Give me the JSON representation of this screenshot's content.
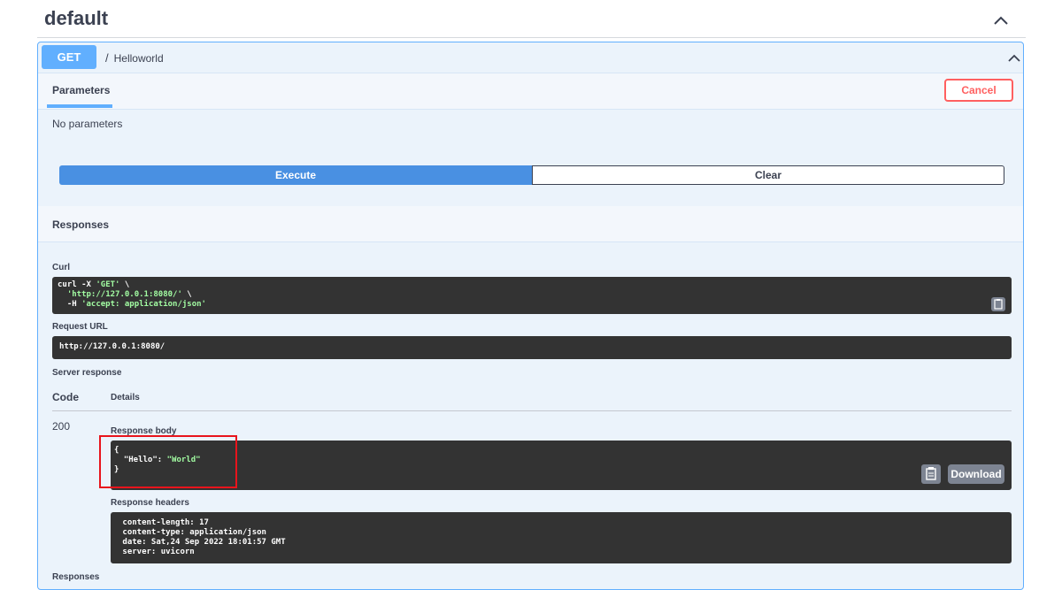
{
  "section": {
    "title": "default"
  },
  "operation": {
    "method": "GET",
    "slash": "/",
    "path": "Helloworld"
  },
  "parameters": {
    "tab_label": "Parameters",
    "cancel_label": "Cancel",
    "empty_text": "No parameters"
  },
  "actions": {
    "execute_label": "Execute",
    "clear_label": "Clear"
  },
  "responses": {
    "title": "Responses",
    "curl_label": "Curl",
    "curl_lines": {
      "l1_cmd": "curl -X ",
      "l1_str": "'GET'",
      "l1_end": " \\",
      "l2_indent": "  ",
      "l2_str": "'http://127.0.0.1:8080/'",
      "l2_end": " \\",
      "l3_cmd": "  -H ",
      "l3_str": "'accept: application/json'"
    },
    "request_url_label": "Request URL",
    "request_url": "http://127.0.0.1:8080/",
    "server_response_label": "Server response",
    "code_header": "Code",
    "details_header": "Details",
    "status_code": "200",
    "response_body_label": "Response body",
    "body_lines": {
      "open": "{",
      "key": "  \"Hello\"",
      "colon": ": ",
      "value": "\"World\"",
      "close": "}"
    },
    "download_label": "Download",
    "response_headers_label": "Response headers",
    "headers": [
      " content-length: 17 ",
      " content-type: application/json ",
      " date: Sat,24 Sep 2022 18:01:57 GMT ",
      " server: uvicorn "
    ],
    "bottom_label": "Responses"
  },
  "colors": {
    "get_accent": "#61affe",
    "execute_blue": "#4990e2",
    "cancel_red": "#ff6060",
    "highlight_red": "#e8141c",
    "code_bg": "#333333"
  }
}
